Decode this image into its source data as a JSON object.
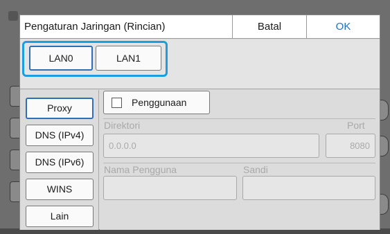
{
  "dialog": {
    "title": "Pengaturan Jaringan (Rincian)",
    "cancel_label": "Batal",
    "ok_label": "OK"
  },
  "lan_tabs": [
    {
      "label": "LAN0",
      "selected": true
    },
    {
      "label": "LAN1",
      "selected": false
    }
  ],
  "side_menu": [
    {
      "label": "Proxy",
      "selected": true
    },
    {
      "label": "DNS (IPv4)",
      "selected": false
    },
    {
      "label": "DNS (IPv6)",
      "selected": false
    },
    {
      "label": "WINS",
      "selected": false
    },
    {
      "label": "Lain",
      "selected": false
    }
  ],
  "proxy": {
    "use_label": "Penggunaan",
    "use_checked": false,
    "directory_label": "Direktori",
    "directory_value": "0.0.0.0",
    "port_label": "Port",
    "port_value": "8080",
    "username_label": "Nama Pengguna",
    "username_value": "",
    "password_label": "Sandi",
    "password_value": ""
  },
  "colors": {
    "accent": "#1f6fc6",
    "highlight": "#1b9de0",
    "disabled_text": "#a9a9a9"
  }
}
